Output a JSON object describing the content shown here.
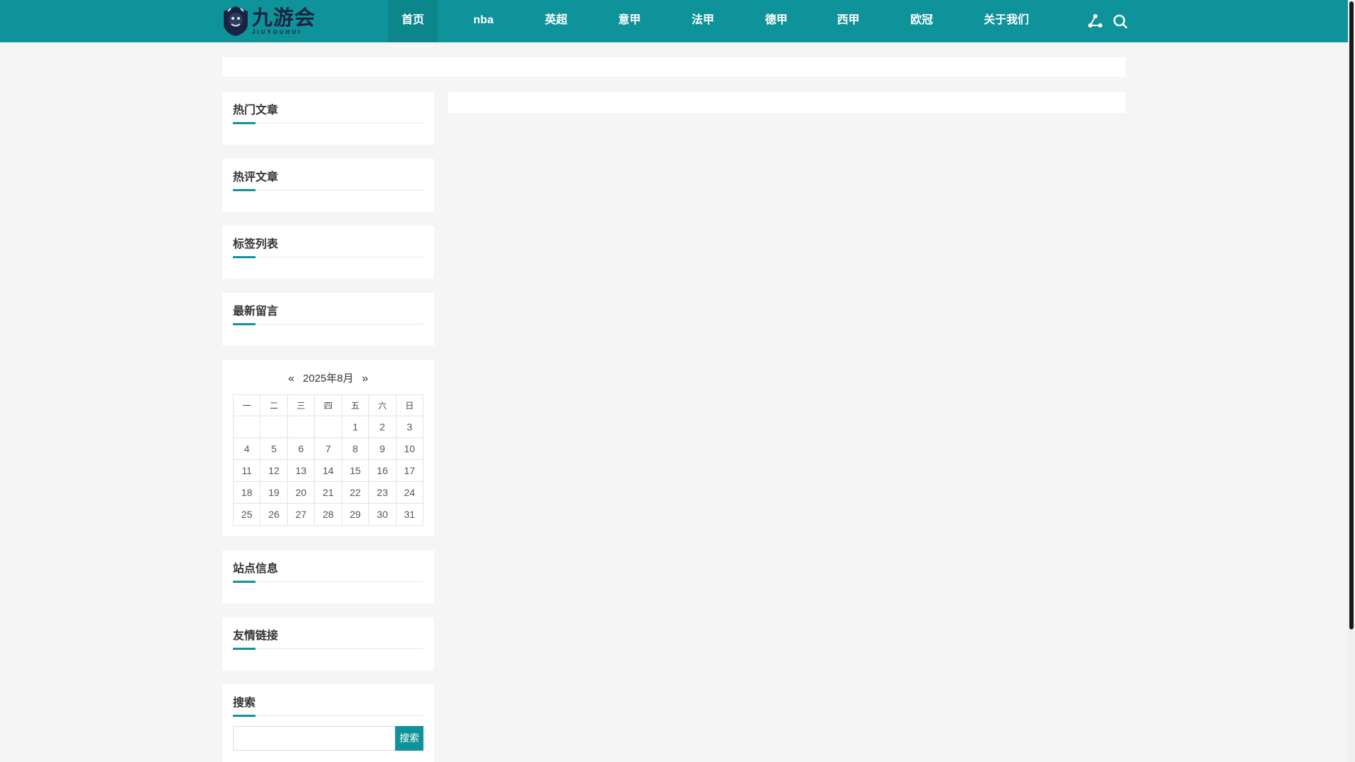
{
  "header": {
    "logo_cn": "九游会",
    "logo_en": "JIUYOUHUI",
    "nav": [
      {
        "label": "首页",
        "active": true
      },
      {
        "label": "nba"
      },
      {
        "label": "英超"
      },
      {
        "label": "意甲"
      },
      {
        "label": "法甲"
      },
      {
        "label": "德甲"
      },
      {
        "label": "西甲"
      },
      {
        "label": "欧冠"
      },
      {
        "label": "关于我们"
      }
    ],
    "icons": [
      "share-network-icon",
      "search-icon"
    ]
  },
  "sidebar": {
    "hot_articles": "热门文章",
    "hot_comments": "热评文章",
    "tags": "标签列表",
    "latest_messages": "最新留言",
    "site_info": "站点信息",
    "friend_links": "友情链接",
    "search_title": "搜索",
    "search_button": "搜索",
    "search_value": ""
  },
  "calendar": {
    "prev": "«",
    "title": "2025年8月",
    "next": "»",
    "weekdays": [
      "一",
      "二",
      "三",
      "四",
      "五",
      "六",
      "日"
    ],
    "weeks": [
      [
        "",
        "",
        "",
        "",
        "1",
        "2",
        "3"
      ],
      [
        "4",
        "5",
        "6",
        "7",
        "8",
        "9",
        "10"
      ],
      [
        "11",
        "12",
        "13",
        "14",
        "15",
        "16",
        "17"
      ],
      [
        "18",
        "19",
        "20",
        "21",
        "22",
        "23",
        "24"
      ],
      [
        "25",
        "26",
        "27",
        "28",
        "29",
        "30",
        "31"
      ]
    ]
  },
  "colors": {
    "brand": "#0f939a",
    "brand_active": "#0c858b",
    "background": "#f5f5f5",
    "panel": "#ffffff"
  }
}
